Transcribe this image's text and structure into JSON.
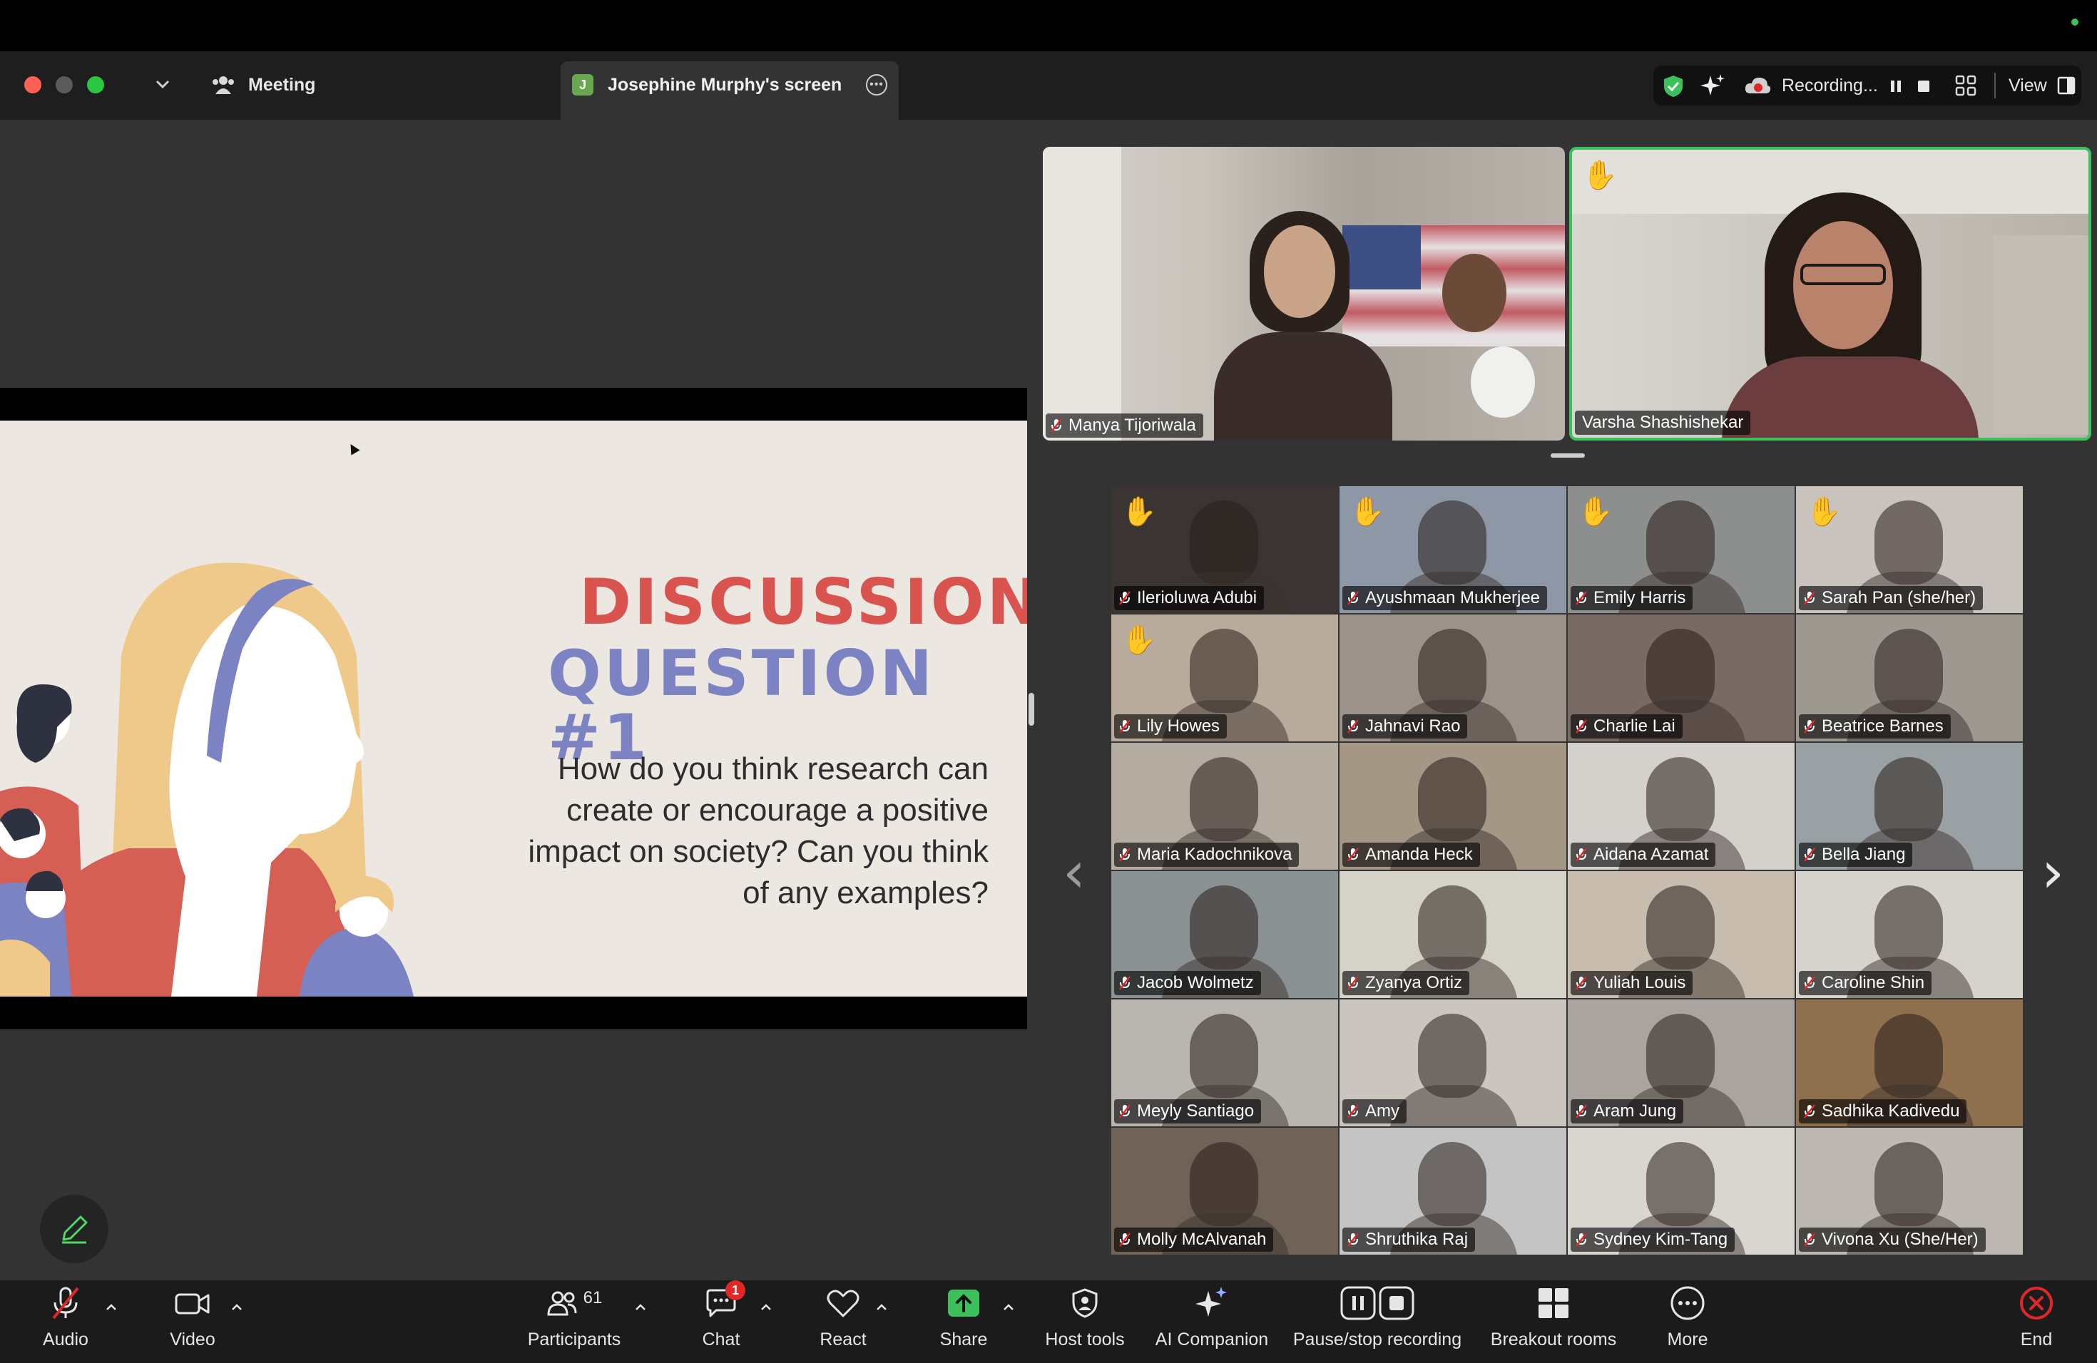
{
  "window": {
    "meeting_tab_label": "Meeting",
    "share_tab_badge": "J",
    "share_tab_label": "Josephine Murphy's screen"
  },
  "recording_bar": {
    "status_text": "Recording...",
    "view_label": "View"
  },
  "slide": {
    "title_line1": "DISCUSSION",
    "title_line2": "QUESTION #1",
    "body": "How do you think research can create or encourage a positive impact on society? Can you think of any examples?"
  },
  "speakers": [
    {
      "name": "Manya Tijoriwala",
      "muted": true,
      "active": false
    },
    {
      "name": "Varsha Shashishekar",
      "muted": false,
      "active": true,
      "hand_raised": true
    }
  ],
  "gallery": [
    {
      "name": "Ilerioluwa Adubi",
      "hand_raised": true,
      "bg": "#3a3533"
    },
    {
      "name": "Ayushmaan Mukherjee",
      "hand_raised": true,
      "bg": "#8d97a5"
    },
    {
      "name": "Emily Harris",
      "hand_raised": true,
      "bg": "#8c8f8e"
    },
    {
      "name": "Sarah Pan (she/her)",
      "hand_raised": true,
      "bg": "#c9c3bd"
    },
    {
      "name": "Lily Howes",
      "hand_raised": true,
      "bg": "#b8ab9b"
    },
    {
      "name": "Jahnavi Rao",
      "hand_raised": false,
      "bg": "#9b928a"
    },
    {
      "name": "Charlie Lai",
      "hand_raised": false,
      "bg": "#7a6a64"
    },
    {
      "name": "Beatrice Barnes",
      "hand_raised": false,
      "bg": "#9d9890"
    },
    {
      "name": "Maria Kadochnikova",
      "hand_raised": false,
      "bg": "#b5aca1"
    },
    {
      "name": "Amanda Heck",
      "hand_raised": false,
      "bg": "#a59786"
    },
    {
      "name": "Aidana Azamat",
      "hand_raised": false,
      "bg": "#d4d1cc"
    },
    {
      "name": "Bella Jiang",
      "hand_raised": false,
      "bg": "#9aa1a4"
    },
    {
      "name": "Jacob Wolmetz",
      "hand_raised": false,
      "bg": "#8a9192"
    },
    {
      "name": "Zyanya Ortiz",
      "hand_raised": false,
      "bg": "#d5d2c8"
    },
    {
      "name": "Yuliah Louis",
      "hand_raised": false,
      "bg": "#c7bcad"
    },
    {
      "name": "Caroline Shin",
      "hand_raised": false,
      "bg": "#d6d2cc"
    },
    {
      "name": "Meyly Santiago",
      "hand_raised": false,
      "bg": "#b9b6b1"
    },
    {
      "name": "Amy",
      "hand_raised": false,
      "bg": "#cac6bf"
    },
    {
      "name": "Aram Jung",
      "hand_raised": false,
      "bg": "#a9a49e"
    },
    {
      "name": "Sadhika Kadivedu",
      "hand_raised": false,
      "bg": "#8e6f4e"
    },
    {
      "name": "Molly McAlvanah",
      "hand_raised": false,
      "bg": "#6f6257"
    },
    {
      "name": "Shruthika Raj",
      "hand_raised": false,
      "bg": "#c3c4c3"
    },
    {
      "name": "Sydney Kim-Tang",
      "hand_raised": false,
      "bg": "#d9d5cf"
    },
    {
      "name": "Vivona Xu (She/Her)",
      "hand_raised": false,
      "bg": "#bdb8b1"
    }
  ],
  "toolbar": {
    "audio": "Audio",
    "video": "Video",
    "participants": "Participants",
    "participants_count": "61",
    "chat": "Chat",
    "chat_badge": "1",
    "react": "React",
    "share": "Share",
    "host_tools": "Host tools",
    "ai_companion": "AI Companion",
    "pause_stop": "Pause/stop recording",
    "breakout": "Breakout rooms",
    "more": "More",
    "end": "End"
  },
  "colors": {
    "accent_green": "#3cc05b",
    "end_red": "#e02828",
    "slide_red": "#d9534f",
    "slide_blue": "#7b83c3"
  },
  "icons": [
    "participants-group-icon",
    "shield-check-icon",
    "sparkle-icon",
    "cloud-record-icon",
    "pause-icon",
    "stop-icon",
    "grid-icon",
    "view-panel-icon",
    "pencil-icon",
    "mic-muted-icon",
    "video-camera-icon",
    "chat-bubble-icon",
    "heart-icon",
    "share-arrow-icon",
    "shield-icon",
    "close-circle-icon",
    "ellipsis-icon"
  ]
}
